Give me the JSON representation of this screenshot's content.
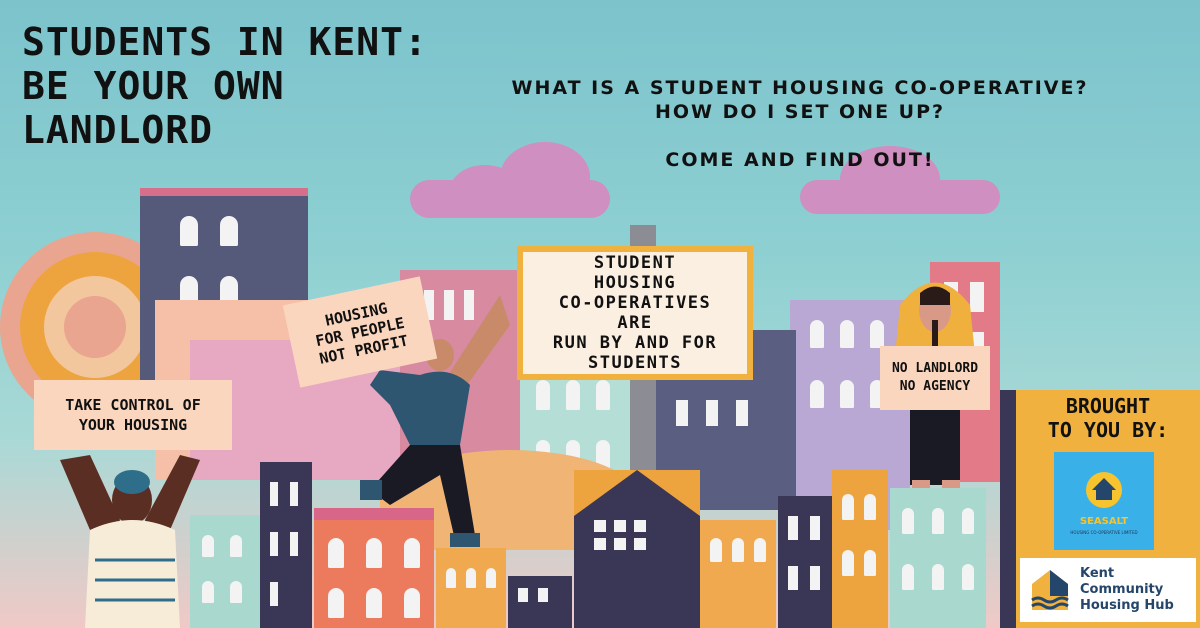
{
  "title": {
    "line1": "STUDENTS IN KENT:",
    "line2": "BE YOUR OWN",
    "line3": "LANDLORD"
  },
  "questions": {
    "line1": "WHAT IS A STUDENT HOUSING CO-OPERATIVE?",
    "line2": "HOW DO I SET ONE UP?",
    "line3": "COME AND FIND OUT!"
  },
  "signs": {
    "center": [
      "STUDENT",
      "HOUSING",
      "CO-OPERATIVES",
      "ARE",
      "RUN BY AND FOR",
      "STUDENTS"
    ],
    "profit": [
      "HOUSING",
      "FOR PEOPLE",
      "NOT PROFIT"
    ],
    "control": [
      "TAKE CONTROL OF",
      "YOUR HOUSING"
    ],
    "landlord": [
      "NO LANDLORD",
      "NO AGENCY"
    ]
  },
  "brought": {
    "line1": "BROUGHT",
    "line2": "TO YOU BY:"
  },
  "logos": {
    "seasalt_name": "SEASALT",
    "seasalt_sub": "HOUSING CO-OPERATIVE LIMITED",
    "kent_line1": "Kent",
    "kent_line2": "Community",
    "kent_line3": "Housing Hub"
  },
  "colors": {
    "sky": "#8ed0d2",
    "cloud": "#cf8fc0",
    "orange": "#eea43e",
    "navy": "#3a3656",
    "salmon": "#ec7a5c",
    "mint": "#a9d8cf",
    "sign_bg": "#fbefe2",
    "seasalt_blue": "#3ab0e8"
  }
}
